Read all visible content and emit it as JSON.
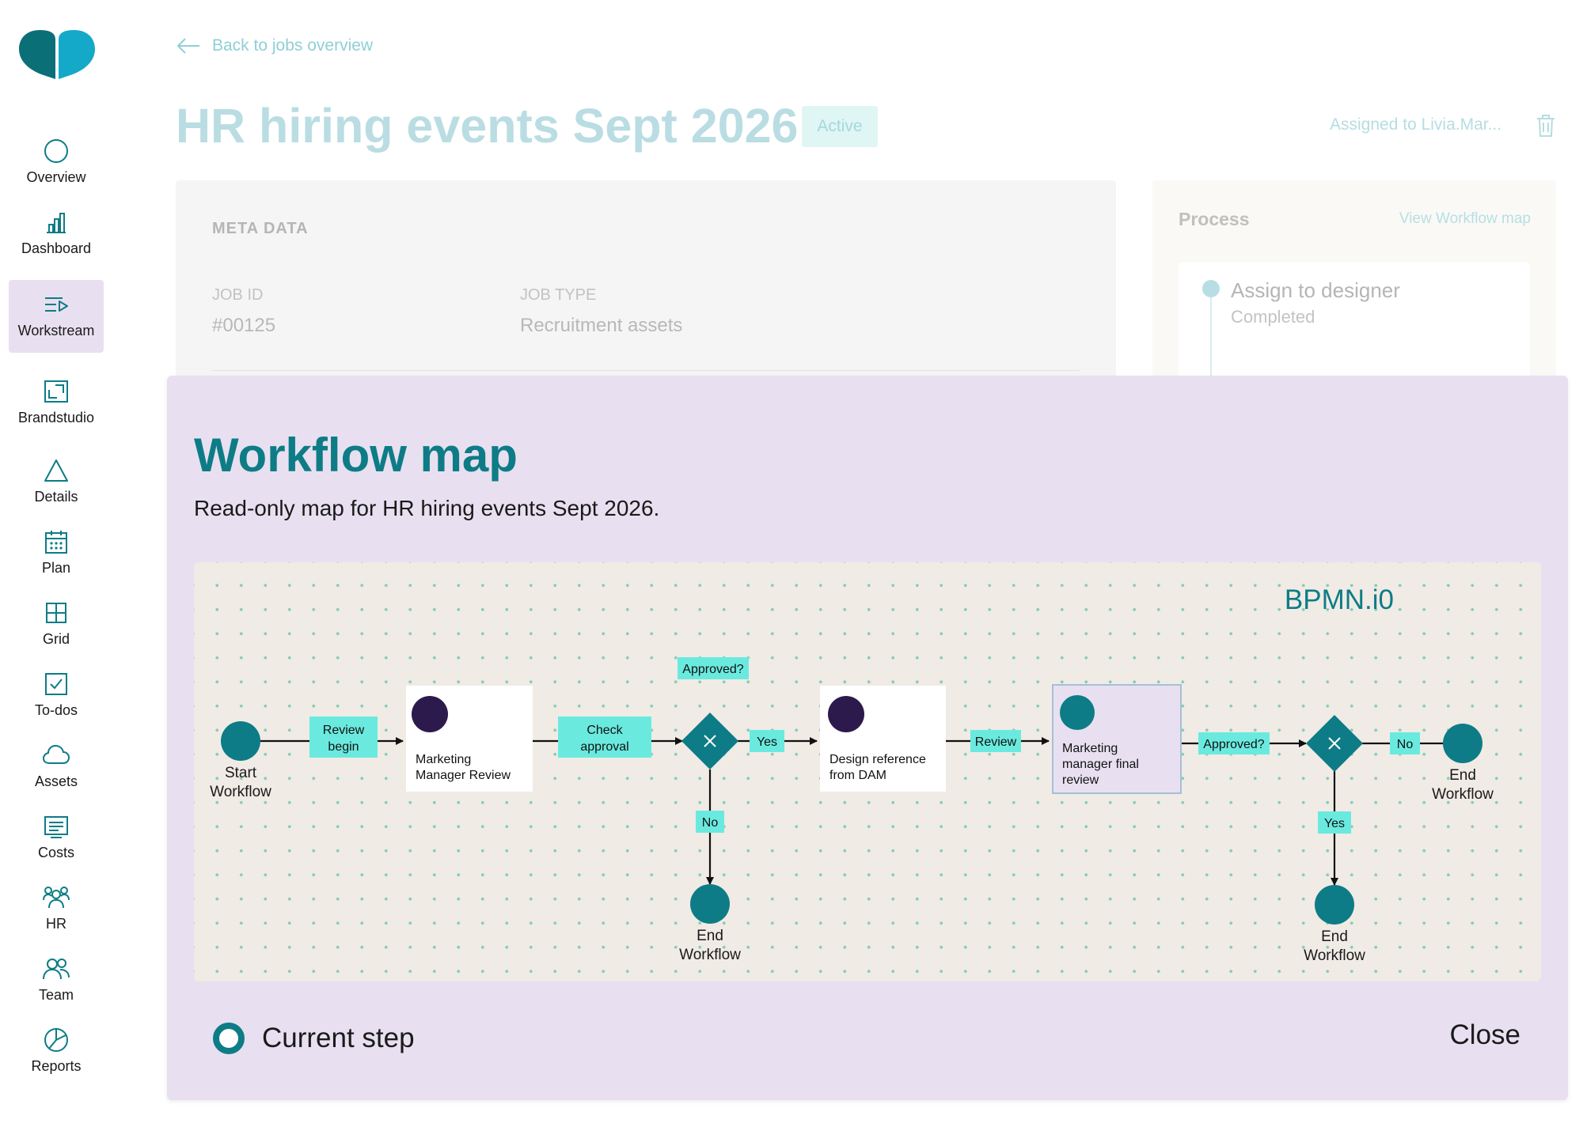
{
  "brand": {
    "colors": {
      "teal": "#0d7c86",
      "purple": "#e8e0f0",
      "mint": "#6aeadf",
      "dark": "#2d1a4c"
    }
  },
  "sidebar": {
    "items": [
      {
        "label": "Overview",
        "icon": "circle-icon"
      },
      {
        "label": "Dashboard",
        "icon": "bar-chart-icon"
      },
      {
        "label": "Workstream",
        "icon": "list-play-icon",
        "active": true
      },
      {
        "label": "Brandstudio",
        "icon": "frame-icon"
      },
      {
        "label": "Details",
        "icon": "triangle-icon"
      },
      {
        "label": "Plan",
        "icon": "calendar-icon"
      },
      {
        "label": "Grid",
        "icon": "grid-icon"
      },
      {
        "label": "To-dos",
        "icon": "checkbox-icon"
      },
      {
        "label": "Assets",
        "icon": "cloud-icon"
      },
      {
        "label": "Costs",
        "icon": "receipt-icon"
      },
      {
        "label": "HR",
        "icon": "people-icon"
      },
      {
        "label": "Team",
        "icon": "team-icon"
      },
      {
        "label": "Reports",
        "icon": "pie-chart-icon"
      }
    ]
  },
  "header": {
    "back_label": "Back to jobs overview",
    "title": "HR hiring events Sept 2026",
    "status": "Active",
    "assigned": "Assigned to Livia.Mar..."
  },
  "meta": {
    "heading": "META DATA",
    "job_id_label": "JOB ID",
    "job_id": "#00125",
    "job_type_label": "JOB TYPE",
    "job_type": "Recruitment assets"
  },
  "process": {
    "title": "Process",
    "link": "View Workflow map",
    "step_name": "Assign to designer",
    "step_status": "Completed"
  },
  "modal": {
    "title": "Workflow map",
    "subtitle": "Read-only map for HR hiring events Sept 2026.",
    "legend_label": "Current step",
    "close_label": "Close"
  },
  "diagram": {
    "watermark": "BPMN.i0",
    "start_event": [
      "Start",
      "Workflow"
    ],
    "end_event_1": [
      "End",
      "Workflow"
    ],
    "end_event_2": [
      "End",
      "Workflow"
    ],
    "end_event_3": [
      "End",
      "Workflow"
    ],
    "task_1": [
      "Marketing",
      "Manager Review"
    ],
    "task_2": [
      "Design reference",
      "from DAM"
    ],
    "task_3": [
      "Marketing",
      "manager final",
      "review"
    ],
    "flow_review_begin": [
      "Review",
      "begin"
    ],
    "flow_check_approval": [
      "Check",
      "approval"
    ],
    "gateway_1_label": "Approved?",
    "flow_yes_1": "Yes",
    "flow_no_1": "No",
    "flow_review": "Review",
    "gateway_2_label": "Approved?",
    "flow_no_2": "No",
    "flow_yes_2": "Yes"
  }
}
